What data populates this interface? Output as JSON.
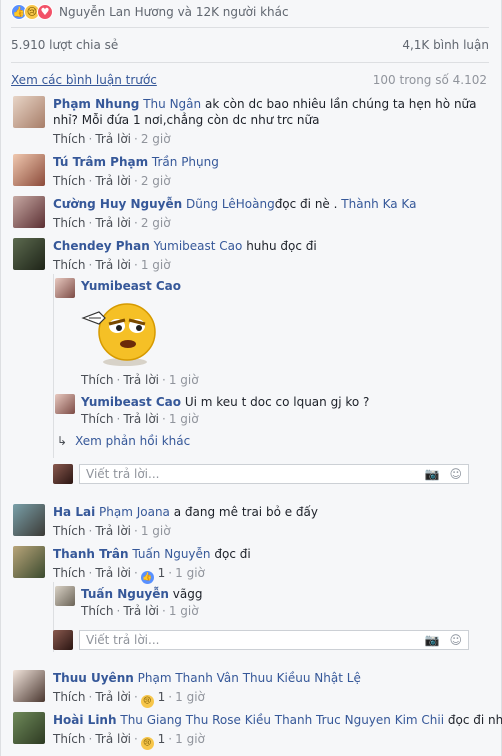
{
  "reactions": {
    "names": "Nguyễn Lan Hương và 12K người khác",
    "icons": [
      "like-icon",
      "sad-icon",
      "love-icon"
    ],
    "like_glyph": "👍",
    "sad_glyph": "😢",
    "love_glyph": "♥"
  },
  "stats": {
    "shares": "5.910 lượt chia sẻ",
    "comments": "4,1K bình luận"
  },
  "more": {
    "link": "Xem các bình luận trước",
    "count": "100 trong số 4.102"
  },
  "labels": {
    "like": "Thích",
    "reply": "Trả lời",
    "sep": "·",
    "reply_placeholder": "Viết trả lời...",
    "more_replies": "Xem phản hồi khác"
  },
  "comments": [
    {
      "name": "Phạm Nhung",
      "tag": "Thu Ngân",
      "text": "ak còn dc bao nhiêu lần chúng ta hẹn hò nữa nhỉ? Mỗi đứa 1 nơi,chẳng còn dc như trc nữa",
      "time": "2 giờ"
    },
    {
      "name": "Tú Trâm Phạm",
      "tag": "Trần Phụng",
      "text": "",
      "time": "2 giờ"
    },
    {
      "name": "Cường Huy Nguyễn",
      "tag": "Dũng LêHoàng",
      "text": "đọc đi nè .",
      "tag2": "Thành Ka Ka",
      "time": "2 giờ"
    },
    {
      "name": "Chendey Phan",
      "tag": "Yumibeast Cao",
      "text": "huhu đọc đi",
      "time": "1 giờ",
      "replies": [
        {
          "name": "Yumibeast Cao",
          "text": "",
          "time": "1 giờ"
        },
        {
          "name": "Yumibeast Cao",
          "text": "Ui m keu t doc co lquan gj ko ?",
          "time": "1 giờ"
        }
      ]
    },
    {
      "name": "Ha Lai",
      "tag": "Phạm Joana",
      "text": "a đang mê trai bỏ e đấy",
      "time": "1 giờ"
    },
    {
      "name": "Thanh Trân",
      "tag": "Tuấn Nguyễn",
      "text": "đọc đi",
      "count": "1",
      "time": "1 giờ",
      "replies": [
        {
          "name": "Tuấn Nguyễn",
          "text": "vãgg",
          "time": "1 giờ"
        }
      ]
    },
    {
      "name": "Thuu Uyênn",
      "tag": "Phạm Thanh Vân",
      "tag2": "Thuu Kiềuu",
      "tag3": "Nhật Lệ",
      "text": "",
      "count": "1",
      "time": "1 giờ"
    },
    {
      "name": "Hoài Linh",
      "tag": "Thu Giang",
      "tag2": "Thu Rose",
      "tag3": "Kiều Thanh Truc",
      "tag4": "Nguyen Kim Chii",
      "text": "đọc đi nha",
      "count": "1",
      "time": "1 giờ"
    }
  ],
  "colors": {
    "link": "#365899",
    "muted": "#90949c",
    "like": "#5890ff",
    "love": "#f25268",
    "sad": "#f7c64a"
  }
}
